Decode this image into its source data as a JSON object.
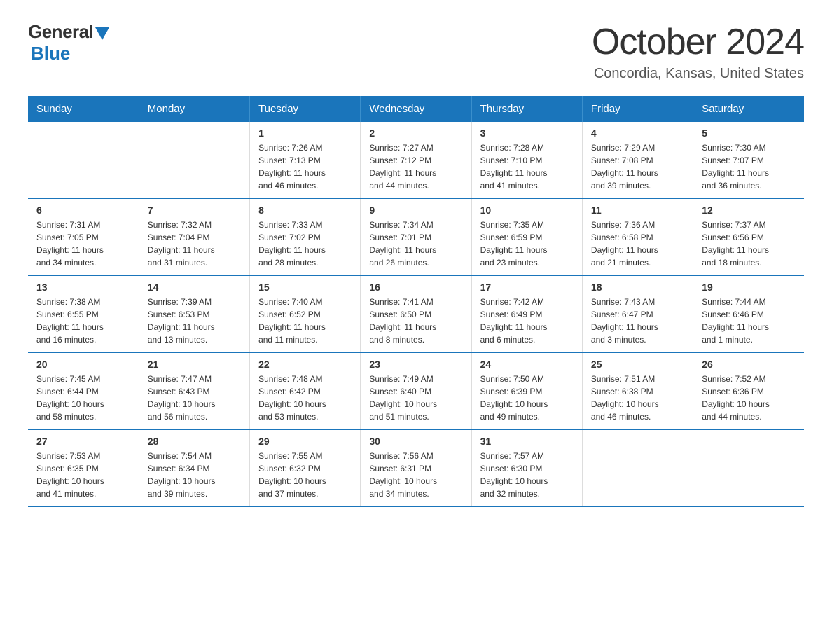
{
  "logo": {
    "general": "General",
    "blue": "Blue"
  },
  "title": "October 2024",
  "location": "Concordia, Kansas, United States",
  "days_of_week": [
    "Sunday",
    "Monday",
    "Tuesday",
    "Wednesday",
    "Thursday",
    "Friday",
    "Saturday"
  ],
  "weeks": [
    [
      {
        "day": "",
        "info": ""
      },
      {
        "day": "",
        "info": ""
      },
      {
        "day": "1",
        "info": "Sunrise: 7:26 AM\nSunset: 7:13 PM\nDaylight: 11 hours\nand 46 minutes."
      },
      {
        "day": "2",
        "info": "Sunrise: 7:27 AM\nSunset: 7:12 PM\nDaylight: 11 hours\nand 44 minutes."
      },
      {
        "day": "3",
        "info": "Sunrise: 7:28 AM\nSunset: 7:10 PM\nDaylight: 11 hours\nand 41 minutes."
      },
      {
        "day": "4",
        "info": "Sunrise: 7:29 AM\nSunset: 7:08 PM\nDaylight: 11 hours\nand 39 minutes."
      },
      {
        "day": "5",
        "info": "Sunrise: 7:30 AM\nSunset: 7:07 PM\nDaylight: 11 hours\nand 36 minutes."
      }
    ],
    [
      {
        "day": "6",
        "info": "Sunrise: 7:31 AM\nSunset: 7:05 PM\nDaylight: 11 hours\nand 34 minutes."
      },
      {
        "day": "7",
        "info": "Sunrise: 7:32 AM\nSunset: 7:04 PM\nDaylight: 11 hours\nand 31 minutes."
      },
      {
        "day": "8",
        "info": "Sunrise: 7:33 AM\nSunset: 7:02 PM\nDaylight: 11 hours\nand 28 minutes."
      },
      {
        "day": "9",
        "info": "Sunrise: 7:34 AM\nSunset: 7:01 PM\nDaylight: 11 hours\nand 26 minutes."
      },
      {
        "day": "10",
        "info": "Sunrise: 7:35 AM\nSunset: 6:59 PM\nDaylight: 11 hours\nand 23 minutes."
      },
      {
        "day": "11",
        "info": "Sunrise: 7:36 AM\nSunset: 6:58 PM\nDaylight: 11 hours\nand 21 minutes."
      },
      {
        "day": "12",
        "info": "Sunrise: 7:37 AM\nSunset: 6:56 PM\nDaylight: 11 hours\nand 18 minutes."
      }
    ],
    [
      {
        "day": "13",
        "info": "Sunrise: 7:38 AM\nSunset: 6:55 PM\nDaylight: 11 hours\nand 16 minutes."
      },
      {
        "day": "14",
        "info": "Sunrise: 7:39 AM\nSunset: 6:53 PM\nDaylight: 11 hours\nand 13 minutes."
      },
      {
        "day": "15",
        "info": "Sunrise: 7:40 AM\nSunset: 6:52 PM\nDaylight: 11 hours\nand 11 minutes."
      },
      {
        "day": "16",
        "info": "Sunrise: 7:41 AM\nSunset: 6:50 PM\nDaylight: 11 hours\nand 8 minutes."
      },
      {
        "day": "17",
        "info": "Sunrise: 7:42 AM\nSunset: 6:49 PM\nDaylight: 11 hours\nand 6 minutes."
      },
      {
        "day": "18",
        "info": "Sunrise: 7:43 AM\nSunset: 6:47 PM\nDaylight: 11 hours\nand 3 minutes."
      },
      {
        "day": "19",
        "info": "Sunrise: 7:44 AM\nSunset: 6:46 PM\nDaylight: 11 hours\nand 1 minute."
      }
    ],
    [
      {
        "day": "20",
        "info": "Sunrise: 7:45 AM\nSunset: 6:44 PM\nDaylight: 10 hours\nand 58 minutes."
      },
      {
        "day": "21",
        "info": "Sunrise: 7:47 AM\nSunset: 6:43 PM\nDaylight: 10 hours\nand 56 minutes."
      },
      {
        "day": "22",
        "info": "Sunrise: 7:48 AM\nSunset: 6:42 PM\nDaylight: 10 hours\nand 53 minutes."
      },
      {
        "day": "23",
        "info": "Sunrise: 7:49 AM\nSunset: 6:40 PM\nDaylight: 10 hours\nand 51 minutes."
      },
      {
        "day": "24",
        "info": "Sunrise: 7:50 AM\nSunset: 6:39 PM\nDaylight: 10 hours\nand 49 minutes."
      },
      {
        "day": "25",
        "info": "Sunrise: 7:51 AM\nSunset: 6:38 PM\nDaylight: 10 hours\nand 46 minutes."
      },
      {
        "day": "26",
        "info": "Sunrise: 7:52 AM\nSunset: 6:36 PM\nDaylight: 10 hours\nand 44 minutes."
      }
    ],
    [
      {
        "day": "27",
        "info": "Sunrise: 7:53 AM\nSunset: 6:35 PM\nDaylight: 10 hours\nand 41 minutes."
      },
      {
        "day": "28",
        "info": "Sunrise: 7:54 AM\nSunset: 6:34 PM\nDaylight: 10 hours\nand 39 minutes."
      },
      {
        "day": "29",
        "info": "Sunrise: 7:55 AM\nSunset: 6:32 PM\nDaylight: 10 hours\nand 37 minutes."
      },
      {
        "day": "30",
        "info": "Sunrise: 7:56 AM\nSunset: 6:31 PM\nDaylight: 10 hours\nand 34 minutes."
      },
      {
        "day": "31",
        "info": "Sunrise: 7:57 AM\nSunset: 6:30 PM\nDaylight: 10 hours\nand 32 minutes."
      },
      {
        "day": "",
        "info": ""
      },
      {
        "day": "",
        "info": ""
      }
    ]
  ]
}
